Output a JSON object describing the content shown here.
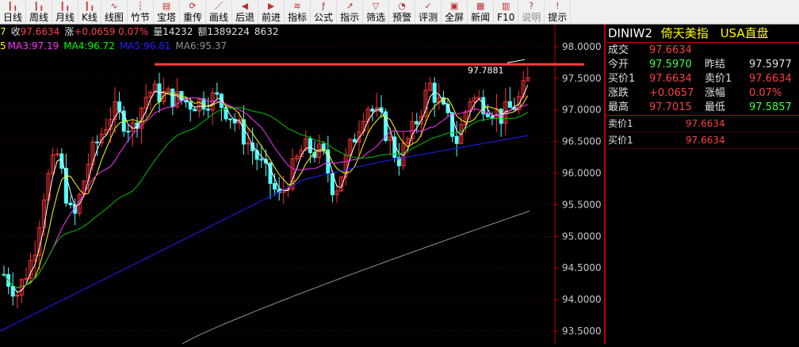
{
  "toolbar": [
    {
      "label": "日线",
      "icon": "kline-icon"
    },
    {
      "label": "周线",
      "icon": "kline-icon"
    },
    {
      "label": "月线",
      "icon": "kline-icon"
    },
    {
      "label": "K线",
      "icon": "kline-icon"
    },
    {
      "label": "线图",
      "icon": "line-icon"
    },
    {
      "label": "竹节",
      "icon": "bar-icon"
    },
    {
      "label": "宝塔",
      "icon": "tower-icon"
    },
    {
      "label": "重传",
      "icon": "refresh-icon"
    },
    {
      "label": "画线",
      "icon": "pen-icon"
    },
    {
      "label": "后退",
      "icon": "back-icon"
    },
    {
      "label": "前进",
      "icon": "forward-icon"
    },
    {
      "label": "指标",
      "icon": "indicator-icon"
    },
    {
      "label": "公式",
      "icon": "formula-icon"
    },
    {
      "label": "指示",
      "icon": "pointer-icon"
    },
    {
      "label": "筛选",
      "icon": "filter-icon"
    },
    {
      "label": "预警",
      "icon": "alarm-icon"
    },
    {
      "label": "评测",
      "icon": "test-icon"
    },
    {
      "label": "全屏",
      "icon": "fullscreen-icon"
    },
    {
      "label": "新闻",
      "icon": "news-icon"
    },
    {
      "label": "F10",
      "icon": "f10-icon"
    },
    {
      "label": "说明",
      "icon": "help-icon",
      "disabled": true
    },
    {
      "label": "提示",
      "icon": "tip-icon"
    }
  ],
  "legend": {
    "close_label": "收",
    "close_value": "97.6634",
    "change": "+0.0659 0.07%",
    "change_label": "涨",
    "volume": "量14232",
    "amount": "额1389224",
    "extra": "8632",
    "prefix1": "7",
    "prefix2": "5",
    "ma3": "MA3:97.19",
    "ma4": "MA4:96.72",
    "ma5": "MA5:96.81",
    "ma6": "MA6:95.37"
  },
  "chart_data": {
    "type": "candlestick",
    "y_ticks": [
      "98.0000",
      "97.5000",
      "97.0000",
      "96.5000",
      "96.0000",
      "95.5000",
      "95.0000",
      "94.5000",
      "94.0000",
      "93.5000"
    ],
    "ylim": [
      93.3,
      98.35
    ],
    "peak_label": "97.7881",
    "resistance_level": 97.72,
    "colors": {
      "up": "#ff3232",
      "down": "#54ffff",
      "ma3": "#ffffff",
      "ma4": "#ffff00",
      "ma5": "#ff33ff",
      "ma6": "#00c000",
      "ma_blue": "#2020ff",
      "ma_gray": "#909090",
      "resistance": "#ff4040"
    }
  },
  "side": {
    "symbol": "DINIW2",
    "name": "倚天美指",
    "market": "USA直盘",
    "rows": [
      [
        {
          "t": "成交",
          "c": "#e0e0e0"
        },
        {
          "t": "97.6634",
          "c": "#ff4040"
        },
        {
          "t": "",
          "c": "#e0e0e0"
        },
        {
          "t": "",
          "c": "#e0e0e0"
        }
      ],
      [
        {
          "t": "今开",
          "c": "#e0e0e0"
        },
        {
          "t": "97.5970",
          "c": "#40ff40"
        },
        {
          "t": "昨结",
          "c": "#e0e0e0"
        },
        {
          "t": "97.5977",
          "c": "#e0e0e0"
        }
      ],
      [
        {
          "t": "买价1",
          "c": "#e0e0e0"
        },
        {
          "t": "97.6634",
          "c": "#ff4040"
        },
        {
          "t": "卖价1",
          "c": "#e0e0e0"
        },
        {
          "t": "97.6634",
          "c": "#ff4040"
        }
      ],
      [
        {
          "t": "涨跌",
          "c": "#e0e0e0"
        },
        {
          "t": "+0.0657",
          "c": "#ff4040"
        },
        {
          "t": "涨幅",
          "c": "#e0e0e0"
        },
        {
          "t": "0.07%",
          "c": "#ff4040"
        }
      ],
      [
        {
          "t": "最高",
          "c": "#e0e0e0"
        },
        {
          "t": "97.7015",
          "c": "#ff4040"
        },
        {
          "t": "最低",
          "c": "#e0e0e0"
        },
        {
          "t": "97.5857",
          "c": "#40ff40"
        }
      ]
    ],
    "book": [
      {
        "label": "卖价1",
        "value": "97.6634"
      },
      {
        "label": "买价1",
        "value": "97.6634"
      }
    ]
  }
}
